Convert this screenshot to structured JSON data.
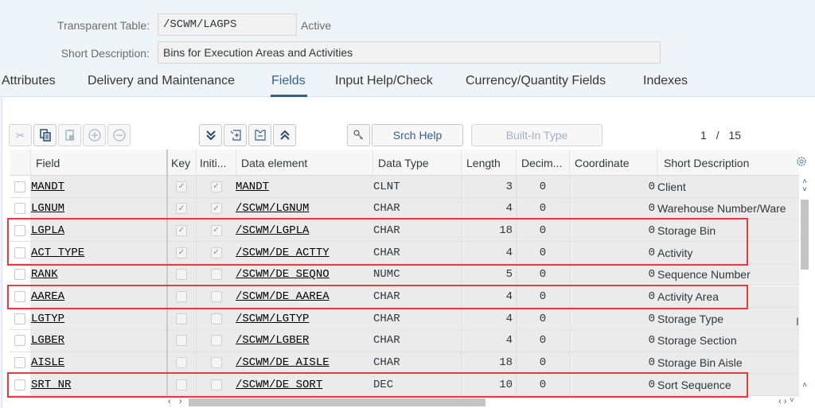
{
  "header": {
    "table_label": "Transparent Table:",
    "table_value": "/SCWM/LAGPS",
    "status": "Active",
    "desc_label": "Short Description:",
    "desc_value": "Bins for Execution Areas and Activities"
  },
  "tabs": [
    {
      "label": "Attributes",
      "active": false
    },
    {
      "label": "Delivery and Maintenance",
      "active": false
    },
    {
      "label": "Fields",
      "active": true
    },
    {
      "label": "Input Help/Check",
      "active": false
    },
    {
      "label": "Currency/Quantity Fields",
      "active": false
    },
    {
      "label": "Indexes",
      "active": false
    }
  ],
  "toolbar": {
    "cut_icon": "scissors-icon",
    "copy_icon": "copy-icon",
    "paste_icon": "paste-icon",
    "insert_icon": "plus-circle-icon",
    "delete_icon": "minus-circle-icon",
    "expand_icon": "double-chevron-down-icon",
    "insert_row_icon": "insert-row-icon",
    "delete_row_icon": "delete-row-icon",
    "collapse_icon": "double-chevron-up-icon",
    "key_icon": "key-icon",
    "srch_help_label": "Srch Help",
    "builtin_type_label": "Built-In Type",
    "pager_current": "1",
    "pager_sep": "/",
    "pager_total": "15"
  },
  "grid": {
    "columns": [
      "Field",
      "Key",
      "Initi...",
      "Data element",
      "Data Type",
      "Length",
      "Decim...",
      "Coordinate",
      "Short Description"
    ],
    "rows": [
      {
        "field": "MANDT",
        "key": true,
        "initial": true,
        "data_element": "MANDT",
        "data_type": "CLNT",
        "length": "3",
        "decimals": "0",
        "coordinate": "0",
        "short_desc": "Client"
      },
      {
        "field": "LGNUM",
        "key": true,
        "initial": true,
        "data_element": "/SCWM/LGNUM",
        "data_type": "CHAR",
        "length": "4",
        "decimals": "0",
        "coordinate": "0",
        "short_desc": "Warehouse Number/Ware"
      },
      {
        "field": "LGPLA",
        "key": true,
        "initial": true,
        "data_element": "/SCWM/LGPLA",
        "data_type": "CHAR",
        "length": "18",
        "decimals": "0",
        "coordinate": "0",
        "short_desc": "Storage Bin"
      },
      {
        "field": "ACT_TYPE",
        "key": true,
        "initial": true,
        "data_element": "/SCWM/DE_ACTTY",
        "data_type": "CHAR",
        "length": "4",
        "decimals": "0",
        "coordinate": "0",
        "short_desc": "Activity"
      },
      {
        "field": "RANK",
        "key": false,
        "initial": false,
        "data_element": "/SCWM/DE_SEQNO",
        "data_type": "NUMC",
        "length": "5",
        "decimals": "0",
        "coordinate": "0",
        "short_desc": "Sequence Number"
      },
      {
        "field": "AAREA",
        "key": false,
        "initial": false,
        "data_element": "/SCWM/DE_AAREA",
        "data_type": "CHAR",
        "length": "4",
        "decimals": "0",
        "coordinate": "0",
        "short_desc": "Activity Area"
      },
      {
        "field": "LGTYP",
        "key": false,
        "initial": false,
        "data_element": "/SCWM/LGTYP",
        "data_type": "CHAR",
        "length": "4",
        "decimals": "0",
        "coordinate": "0",
        "short_desc": "Storage Type"
      },
      {
        "field": "LGBER",
        "key": false,
        "initial": false,
        "data_element": "/SCWM/LGBER",
        "data_type": "CHAR",
        "length": "4",
        "decimals": "0",
        "coordinate": "0",
        "short_desc": "Storage Section"
      },
      {
        "field": "AISLE",
        "key": false,
        "initial": false,
        "data_element": "/SCWM/DE_AISLE",
        "data_type": "CHAR",
        "length": "18",
        "decimals": "0",
        "coordinate": "0",
        "short_desc": "Storage Bin Aisle"
      },
      {
        "field": "SRT_NR",
        "key": false,
        "initial": false,
        "data_element": "/SCWM/DE_SORT",
        "data_type": "DEC",
        "length": "10",
        "decimals": "0",
        "coordinate": "0",
        "short_desc": "Sort Sequence"
      }
    ],
    "highlighted_rows": [
      [
        2,
        3
      ],
      [
        5,
        5
      ],
      [
        9,
        9
      ]
    ],
    "settings_icon": "gear-icon"
  },
  "colors": {
    "accent": "#346187",
    "highlight": "#e8393f",
    "row_bg": "#ebebeb",
    "page_bg": "#eff4f9"
  }
}
